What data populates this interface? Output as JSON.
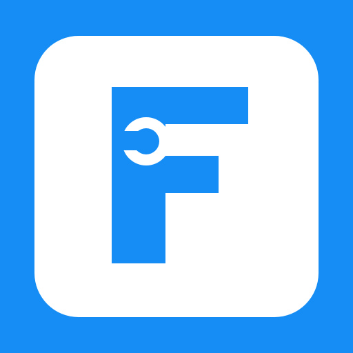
{
  "app_icon": {
    "icon": "letter-f-with-wrench-icon",
    "colors": {
      "background": "#158df5",
      "tile": "#ffffff",
      "glyph": "#158df5"
    }
  }
}
